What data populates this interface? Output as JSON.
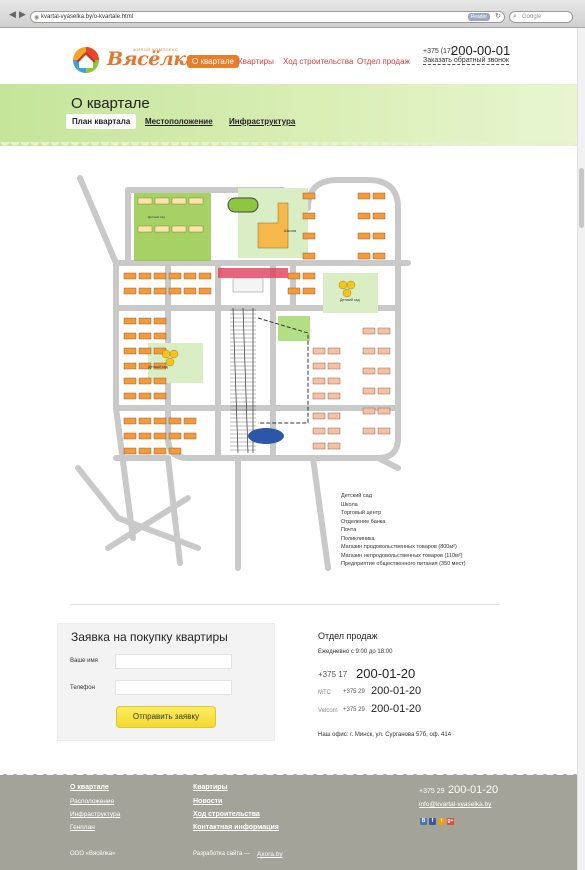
{
  "browser": {
    "url": "kvartal-vyaselka.by/o-kvartale.html",
    "reader_label": "Reader",
    "search_placeholder": "Google"
  },
  "header": {
    "logo_name": "Вясёлка",
    "logo_tagline": "ЖИЛОЙ КОМПЛЕКС",
    "nav": [
      {
        "label": "О квартале",
        "active": true
      },
      {
        "label": "Квартиры",
        "active": false
      },
      {
        "label": "Ход строительства",
        "active": false
      },
      {
        "label": "Отдел продаж",
        "active": false
      }
    ],
    "phone_prefix": "+375 (17)",
    "phone_number": "200-00-01",
    "callback_label": "Заказать обратный звонок"
  },
  "page": {
    "title": "О квартале",
    "subtabs": [
      {
        "label": "План квартала",
        "active": true
      },
      {
        "label": "Местоположение",
        "active": false
      },
      {
        "label": "Инфраструктура",
        "active": false
      }
    ]
  },
  "map": {
    "labels": {
      "school": "Школа",
      "kindergarten1": "Детский сад",
      "kindergarten2": "Детский сад",
      "kindergarten3": "Детский сад"
    },
    "legend": [
      "Детский сад",
      "Школа",
      "Торговый центр",
      "Отделение банка",
      "Почта",
      "Поликлиника",
      "Магазин продовольственных товаров (800м²)",
      "Магазин непродовольственных товаров (110м²)",
      "Предприятие общественного питания (350 мест)"
    ]
  },
  "form": {
    "title": "Заявка на покупку квартиры",
    "name_label": "Ваше имя",
    "name_value": "",
    "phone_label": "Телефон",
    "phone_value": "",
    "submit_label": "Отправить заявку"
  },
  "sales": {
    "title": "Отдел продаж",
    "hours": "Ежедневно с 9:00 до 18:00",
    "phones": [
      {
        "operator": "",
        "prefix": "+375 17",
        "number": "200-01-20"
      },
      {
        "operator": "МТС",
        "prefix": "+375 29",
        "number": "200-01-20"
      },
      {
        "operator": "Velcom",
        "prefix": "+375 29",
        "number": "200-01-20"
      }
    ],
    "office": "Наш офис: г. Минск, ул. Сурганова 57б, оф. 414"
  },
  "footer": {
    "col1": [
      "О квартале",
      "Расположение",
      "Инфраструктура",
      "Генплан"
    ],
    "col2": [
      "Квартиры",
      "Новости",
      "Ход строительства",
      "Контактная информация"
    ],
    "phone_prefix": "+375 29",
    "phone_number": "200-01-20",
    "email": "info@kvartal-vyaselka.by",
    "social": [
      "В",
      "f",
      "t",
      "g+"
    ],
    "copyright": "ООО «Вясёлка»",
    "developer_label": "Разработка сайта — ",
    "developer_link": "Axora.by"
  },
  "colors": {
    "accent_orange": "#e97e2a",
    "nav_red": "#d23d3d",
    "band_green": "#c5e59a",
    "footer_gray": "#a3a39a",
    "button_yellow": "#f3d930"
  }
}
